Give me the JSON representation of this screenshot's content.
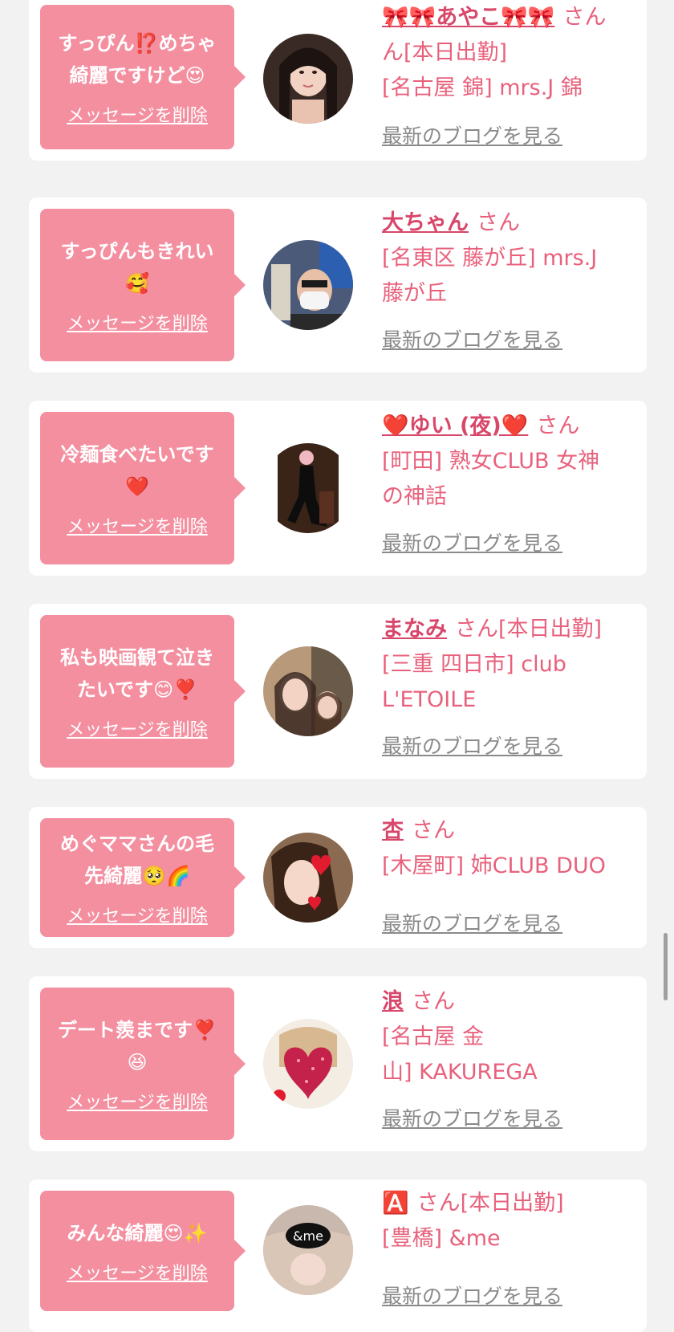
{
  "delete_label": "メッセージを削除",
  "blog_label": "最新のブログを見る",
  "san_label": "さん",
  "colors": {
    "bubble": "#f48fa0",
    "name": "#d8476a",
    "text": "#e8617c",
    "link_gray": "#8a8a8a"
  },
  "cards": [
    {
      "message_lines": [
        "すっぴん⁉️めちゃ",
        "綺麗ですけど😍"
      ],
      "name": "🎀🎀あやこ🎀🎀",
      "badge": "",
      "store_lines": [
        "ん[本日出勤]",
        "[名古屋 錦] mrs.J 錦"
      ],
      "avatar_icon": "woman-portrait-icon"
    },
    {
      "message_lines": [
        "すっぴんもきれい",
        "🥰"
      ],
      "name": "大ちゃん",
      "badge": "",
      "store_lines": [
        "[名東区 藤が丘] mrs.J",
        "藤が丘"
      ],
      "avatar_icon": "man-selfie-icon"
    },
    {
      "message_lines": [
        "冷麺食べたいです",
        "❤️"
      ],
      "name": "❤️ゆい (夜)❤️",
      "badge": "",
      "store_lines": [
        "[町田] 熟女CLUB 女神",
        "の神話"
      ],
      "avatar_icon": "woman-dress-icon"
    },
    {
      "message_lines": [
        "私も映画観て泣き",
        "たいです😊❣️"
      ],
      "name": "まなみ",
      "badge": "[本日出勤]",
      "store_lines": [
        "[三重 四日市] club",
        "L'ETOILE"
      ],
      "avatar_icon": "two-women-icon"
    },
    {
      "message_lines": [
        "めぐママさんの毛",
        "先綺麗🥺🌈"
      ],
      "name": "杏",
      "badge": "",
      "store_lines": [
        "[木屋町] 姉CLUB DUO"
      ],
      "avatar_icon": "heart-face-icon"
    },
    {
      "message_lines": [
        "デート羨まです❣️",
        "😆"
      ],
      "name": "浪",
      "badge": "",
      "store_lines": [
        "[名古屋 金",
        "山] KAKUREGA"
      ],
      "avatar_icon": "glitter-heart-icon"
    },
    {
      "message_lines": [
        "みんな綺麗😍✨"
      ],
      "name": "🅰️",
      "badge": "[本日出勤]",
      "store_lines": [
        "[豊橋] &me"
      ],
      "avatar_icon": "andme-logo-icon"
    }
  ]
}
